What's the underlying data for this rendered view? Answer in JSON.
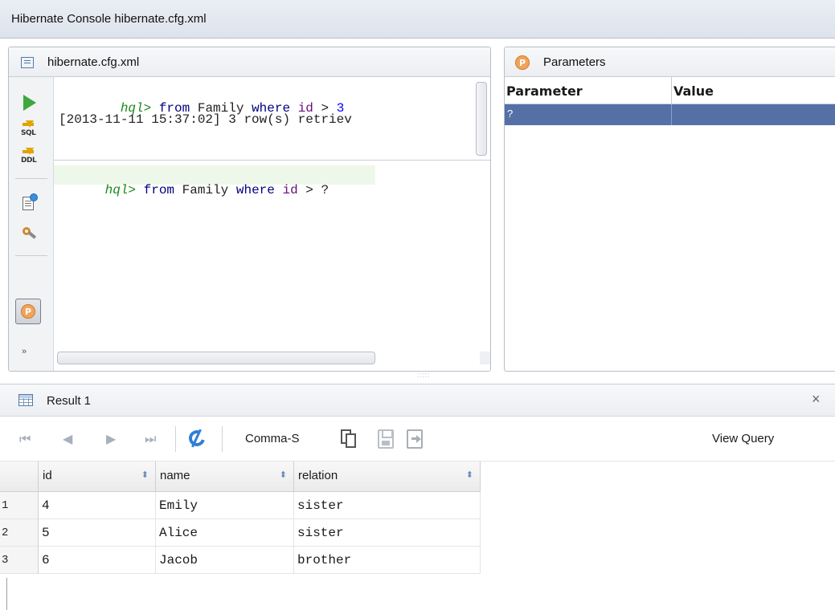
{
  "window": {
    "title": "Hibernate Console  hibernate.cfg.xml"
  },
  "console": {
    "tab_title": "hibernate.cfg.xml",
    "history": {
      "prompt": "hql>",
      "kw_from": "from",
      "entity": "Family",
      "kw_where": "where",
      "field": "id",
      "op": ">",
      "value": "3",
      "log_line": "[2013-11-11 15:37:02] 3 row(s) retriev"
    },
    "input": {
      "prompt": "hql>",
      "kw_from": "from",
      "entity": "Family",
      "kw_where": "where",
      "field": "id",
      "op": ">",
      "param": "?"
    },
    "tools": {
      "run": "run-icon",
      "sql_label": "SQL",
      "ddl_label": "DDL",
      "param_badge": "P",
      "more": "»"
    }
  },
  "parameters": {
    "title": "Parameters",
    "badge": "P",
    "columns": [
      "Parameter",
      "Value"
    ],
    "rows": [
      {
        "parameter": "?",
        "value": ""
      }
    ]
  },
  "result": {
    "title": "Result 1",
    "close": "×",
    "toolbar": {
      "first": "⏮",
      "prev": "◀",
      "next": "▶",
      "last": "⏭",
      "format_label": "Comma-S",
      "view_query_label": "View Query"
    },
    "columns": [
      {
        "name": "id",
        "sort": "⬍"
      },
      {
        "name": "name",
        "sort": "⬍"
      },
      {
        "name": "relation",
        "sort": "⬍"
      }
    ],
    "rows": [
      {
        "num": "1",
        "id": "4",
        "name": "Emily",
        "relation": "sister"
      },
      {
        "num": "2",
        "id": "5",
        "name": "Alice",
        "relation": "sister"
      },
      {
        "num": "3",
        "id": "6",
        "name": "Jacob",
        "relation": "brother"
      }
    ]
  },
  "colors": {
    "hql_prompt": "#1a8a1a",
    "keyword": "#000080",
    "identifier": "#660e7a",
    "number": "#0000ff",
    "selection": "#5470a6",
    "accent_blue": "#2f7fd6"
  }
}
